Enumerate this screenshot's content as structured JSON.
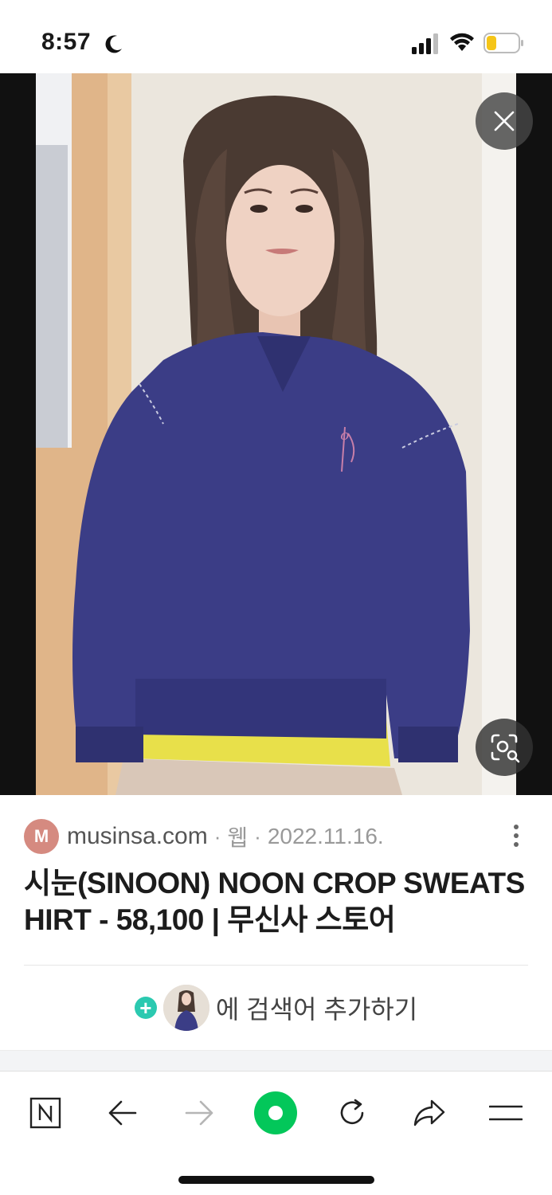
{
  "status_bar": {
    "time": "8:57",
    "battery_color": "#f5c518"
  },
  "viewer": {
    "close_icon": "close-icon",
    "lens_icon": "image-search-icon",
    "photo_colors": {
      "background_wall": "#ebe6dd",
      "door_frame": "#e2b88a",
      "sweatshirt": "#3b3d86",
      "undershirt": "#e8e04a",
      "hair": "#4a3a32",
      "skin": "#efd2c3",
      "skirt": "#d9c7b8",
      "logo": "#c77fa9"
    }
  },
  "result": {
    "favicon_letter": "M",
    "domain": "musinsa.com",
    "separator": "·",
    "type_label": "웹",
    "date": "2022.11.16.",
    "title": "시눈(SINOON) NOON CROP SWEATSHIRT - 58,100 | 무신사 스토어",
    "add_search_label": "에 검색어 추가하기",
    "accent_color": "#2bc9b0"
  },
  "toolbar": {
    "items": [
      {
        "name": "naver-home",
        "icon": "naver-n-icon"
      },
      {
        "name": "back",
        "icon": "arrow-left-icon"
      },
      {
        "name": "forward",
        "icon": "arrow-right-icon"
      },
      {
        "name": "green-dot",
        "icon": "green-dot-icon"
      },
      {
        "name": "reload",
        "icon": "reload-icon"
      },
      {
        "name": "share",
        "icon": "share-icon"
      },
      {
        "name": "menu",
        "icon": "menu-icon"
      }
    ],
    "brand_color": "#03c75a"
  }
}
